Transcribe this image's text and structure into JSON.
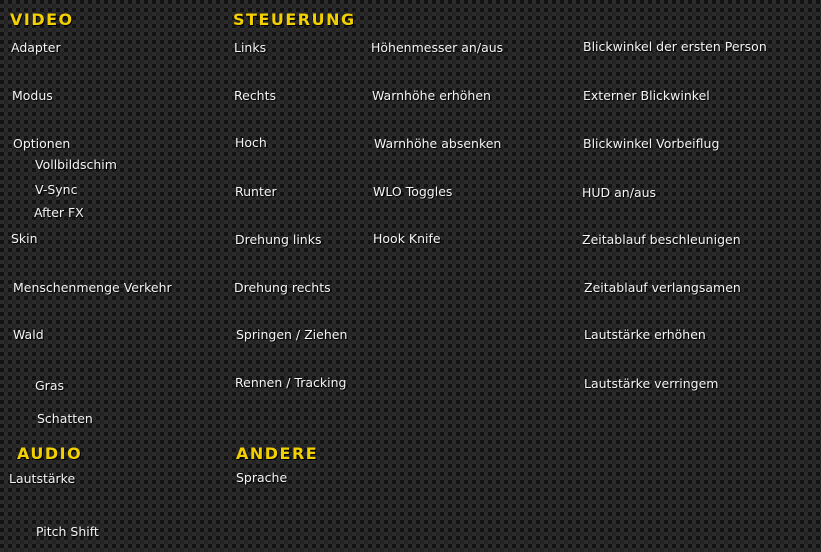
{
  "video": {
    "heading": "VIDEO",
    "adapter": "Adapter",
    "modus": "Modus",
    "optionen": "Optionen",
    "vollbild": "Vollbildschim",
    "vsync": "V-Sync",
    "afterfx": "After FX",
    "skin": "Skin",
    "menschenmenge": "Menschenmenge Verkehr",
    "wald": "Wald",
    "gras": "Gras",
    "schatten": "Schatten"
  },
  "audio": {
    "heading": "AUDIO",
    "lautstaerke": "Lautstärke",
    "pitch": "Pitch Shift"
  },
  "steuerung": {
    "heading": "STEUERUNG",
    "col1": [
      "Links",
      "Rechts",
      "Hoch",
      "Runter",
      "Drehung links",
      "Drehung rechts",
      "Springen / Ziehen",
      "Rennen / Tracking"
    ],
    "col2": [
      "Höhenmesser an/aus",
      "Warnhöhe erhöhen",
      "Warnhöhe absenken",
      "WLO Toggles",
      "Hook Knife"
    ],
    "col3": [
      "Blickwinkel der ersten Person",
      "Externer Blickwinkel",
      "Blickwinkel Vorbeiflug",
      "HUD an/aus",
      "Zeitablauf beschleunigen",
      "Zeitablauf verlangsamen",
      "Lautstärke erhöhen",
      "Lautstärke verringem"
    ]
  },
  "andere": {
    "heading": "ANDERE",
    "sprache": "Sprache"
  },
  "colors": {
    "heading": "#f3d000",
    "text": "#f4f4f4"
  }
}
